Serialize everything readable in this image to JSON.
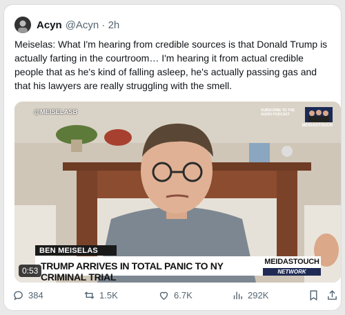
{
  "author": {
    "name": "Acyn",
    "handle": "@Acyn · 2h"
  },
  "tweet": {
    "text": "Meiselas: What I'm hearing from credible sources is that Donald Trump is actually farting in the courtroom… I'm hearing it from actual credible people that as he's kind of falling asleep, he's actually passing gas and that his lawyers are really struggling with the smell."
  },
  "video": {
    "watermark": "@MEISELASB",
    "promo_text": "Subscribe to the audio podcast",
    "promo_brand": "MEIDASTOUCH",
    "name_tag": "BEN MEISELAS",
    "headline": "TRUMP ARRIVES IN TOTAL PANIC TO NY CRIMINAL TRIAL",
    "brand_top": "MEIDASTOUCH",
    "brand_bottom": "NETWORK",
    "timestamp": "0:53"
  },
  "actions": {
    "replies": "384",
    "reposts": "1.5K",
    "likes": "6.7K",
    "views": "292K"
  },
  "icons": {
    "reply": "reply-icon",
    "repost": "repost-icon",
    "like": "heart-icon",
    "views": "views-icon",
    "bookmark": "bookmark-icon",
    "share": "share-icon"
  }
}
